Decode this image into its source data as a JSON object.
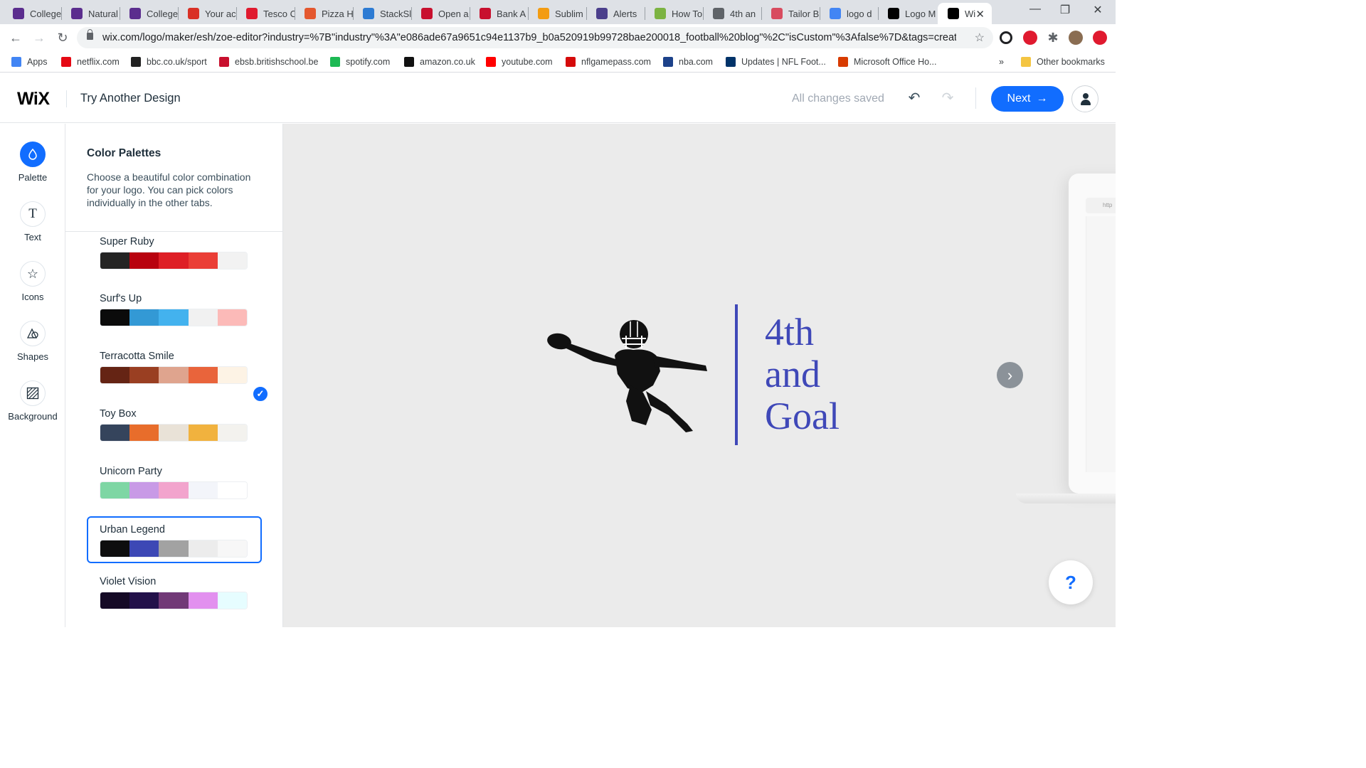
{
  "browser": {
    "tabs": [
      {
        "title": "College",
        "icon": "shield-icon",
        "color": "#5b2d8e"
      },
      {
        "title": "Natural",
        "icon": "shield-icon",
        "color": "#5b2d8e"
      },
      {
        "title": "College",
        "icon": "shield-icon",
        "color": "#5b2d8e"
      },
      {
        "title": "Your ac",
        "icon": "gmail-icon",
        "color": "#d93025"
      },
      {
        "title": "Tesco C",
        "icon": "tesco-icon",
        "color": "#e01a2f"
      },
      {
        "title": "Pizza H",
        "icon": "pizza-icon",
        "color": "#e4572e"
      },
      {
        "title": "StackSl",
        "icon": "stack-icon",
        "color": "#2d7bd3"
      },
      {
        "title": "Open a",
        "icon": "bank-icon",
        "color": "#c8102e"
      },
      {
        "title": "Bank A",
        "icon": "bank-icon",
        "color": "#c8102e"
      },
      {
        "title": "Sublim",
        "icon": "sublime-icon",
        "color": "#f39c12"
      },
      {
        "title": "Alerts",
        "icon": "b-icon",
        "color": "#4b3f8c"
      },
      {
        "title": "How To",
        "icon": "howto-icon",
        "color": "#7cb342"
      },
      {
        "title": "4th an",
        "icon": "globe-icon",
        "color": "#5f6368"
      },
      {
        "title": "Tailor B",
        "icon": "tailor-icon",
        "color": "#d84b5f"
      },
      {
        "title": "logo d",
        "icon": "google-icon",
        "color": "#4285f4"
      },
      {
        "title": "Logo M",
        "icon": "wix-icon",
        "color": "#000000"
      },
      {
        "title": "Wi",
        "icon": "wix-icon",
        "color": "#000000"
      }
    ],
    "url": "wix.com/logo/maker/esh/zoe-editor?industry=%7B\"industry\"%3A\"e086ade67a9651c94e1137b9_b0a520919b99728bae200018_football%20blog\"%2C\"isCustom\"%3Afalse%7D&tags=creative...",
    "bookmarks": [
      {
        "label": "Apps",
        "icon": "apps-grid-icon",
        "color": "#4285f4"
      },
      {
        "label": "netflix.com",
        "icon": "netflix-icon",
        "color": "#e50914"
      },
      {
        "label": "bbc.co.uk/sport",
        "icon": "bbc-icon",
        "color": "#222222"
      },
      {
        "label": "ebsb.britishschool.be",
        "icon": "ebsb-icon",
        "color": "#c8102e"
      },
      {
        "label": "spotify.com",
        "icon": "spotify-icon",
        "color": "#1db954"
      },
      {
        "label": "amazon.co.uk",
        "icon": "amazon-icon",
        "color": "#111111"
      },
      {
        "label": "youtube.com",
        "icon": "youtube-icon",
        "color": "#ff0000"
      },
      {
        "label": "nflgamepass.com",
        "icon": "nfl-icon",
        "color": "#d50a0a"
      },
      {
        "label": "nba.com",
        "icon": "nba-icon",
        "color": "#1d428a"
      },
      {
        "label": "Updates | NFL Foot...",
        "icon": "nfl-shield-icon",
        "color": "#013369"
      },
      {
        "label": "Microsoft Office Ho...",
        "icon": "office-icon",
        "color": "#d83b01"
      },
      {
        "label": "Other bookmarks",
        "icon": "folder-icon",
        "color": "#f4c542"
      }
    ],
    "more_bookmarks": "»"
  },
  "header": {
    "logo": "WiX",
    "title": "Try Another Design",
    "status": "All changes saved",
    "next_label": "Next",
    "accent": "#116dff"
  },
  "rail": [
    {
      "label": "Palette",
      "icon": "palette-drop-icon",
      "active": true
    },
    {
      "label": "Text",
      "icon": "text-icon",
      "active": false
    },
    {
      "label": "Icons",
      "icon": "star-icon",
      "active": false
    },
    {
      "label": "Shapes",
      "icon": "shapes-icon",
      "active": false
    },
    {
      "label": "Background",
      "icon": "background-hatch-icon",
      "active": false
    }
  ],
  "panel": {
    "title": "Color Palettes",
    "description": "Choose a beautiful color combination for your logo. You can pick colors individually in the other tabs.",
    "palettes": [
      {
        "name": "Super Ruby",
        "colors": [
          "#242424",
          "#b8020f",
          "#de1f26",
          "#ea3e36",
          "#f2f2f2"
        ],
        "selected": false
      },
      {
        "name": "Surf's Up",
        "colors": [
          "#0b0b0b",
          "#3399d5",
          "#43b2ee",
          "#f1f1f1",
          "#fcbab8"
        ],
        "selected": false
      },
      {
        "name": "Terracotta Smile",
        "colors": [
          "#652414",
          "#9a3f22",
          "#dfa48e",
          "#e9643b",
          "#fdf3e5"
        ],
        "selected": false
      },
      {
        "name": "Toy Box",
        "colors": [
          "#35445c",
          "#e86d2b",
          "#e9e2d7",
          "#f1b23e",
          "#f3f2ee"
        ],
        "selected": false
      },
      {
        "name": "Unicorn Party",
        "colors": [
          "#7ed6a4",
          "#c89ae6",
          "#f2a4cd",
          "#f3f5fa",
          "#ffffff"
        ],
        "selected": false
      },
      {
        "name": "Urban Legend",
        "colors": [
          "#0e0e0e",
          "#3d48b5",
          "#a2a2a2",
          "#ececec",
          "#f7f7f7"
        ],
        "selected": true
      },
      {
        "name": "Violet Vision",
        "colors": [
          "#150a26",
          "#23114a",
          "#713977",
          "#e290ef",
          "#e6fdff"
        ],
        "selected": false
      }
    ]
  },
  "logo": {
    "line1": "4th",
    "line2": "and",
    "line3": "Goal",
    "text_color": "#3f48b8",
    "figure_color": "#111111",
    "figure_icon": "football-player-icon"
  },
  "canvas": {
    "bg": "#ebebeb",
    "mockup_url": "http",
    "help_label": "?"
  }
}
